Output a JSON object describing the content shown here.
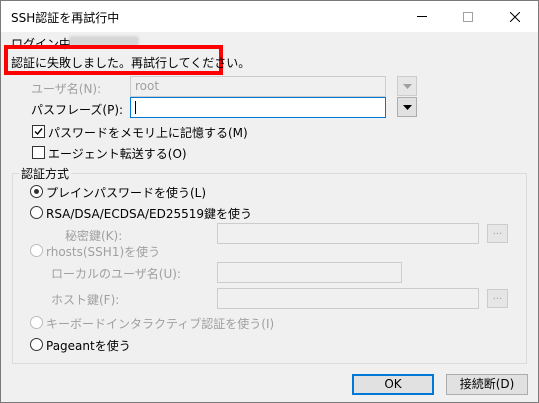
{
  "window": {
    "title": "SSH認証を再試行中",
    "controls": {
      "minimize": "—",
      "maximize": "☐",
      "close": "✕"
    }
  },
  "login_label": "ログイン中:",
  "alert_text": "認証に失敗しました。再試行してください。",
  "username": {
    "label": "ユーザ名(N):",
    "value": "root"
  },
  "passphrase": {
    "label": "パスフレーズ(P):",
    "value": ""
  },
  "remember_password": {
    "label": "パスワードをメモリ上に記憶する(M)",
    "checked": true
  },
  "agent_forwarding": {
    "label": "エージェント転送する(O)",
    "checked": false
  },
  "auth_method": {
    "group_label": "認証方式",
    "options": {
      "plain_password": "プレインパスワードを使う(L)",
      "key_file": "RSA/DSA/ECDSA/ED25519鍵を使う",
      "private_key_label": "秘密鍵(K):",
      "rhosts": "rhosts(SSH1)を使う",
      "local_user_label": "ローカルのユーザ名(U):",
      "host_key_label": "ホスト鍵(F):",
      "keyboard_interactive": "キーボードインタラクティブ認証を使う(I)",
      "pageant": "Pageantを使う"
    },
    "selected": "plain_password",
    "browse_label": "..."
  },
  "buttons": {
    "ok": "OK",
    "disconnect": "接続断(D)"
  }
}
